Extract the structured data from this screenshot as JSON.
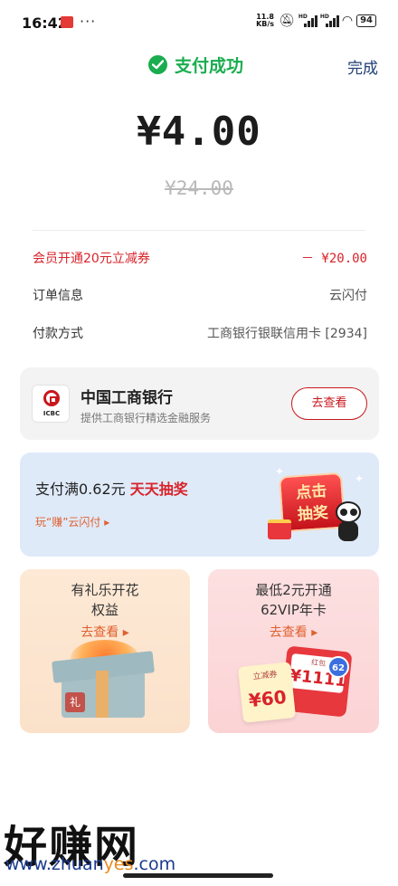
{
  "status_bar": {
    "time": "16:42",
    "network_speed": "11.8\nKB/s",
    "signal_label_1": "HD",
    "signal_label_2": "HD",
    "battery": "94"
  },
  "header": {
    "title": "支付成功",
    "done_label": "完成"
  },
  "payment": {
    "amount": "¥4.00",
    "original_amount": "¥24.00"
  },
  "details": [
    {
      "label": "会员开通20元立减券",
      "value": "－ ¥20.00"
    },
    {
      "label": "订单信息",
      "value": "云闪付"
    },
    {
      "label": "付款方式",
      "value": "工商银行银联信用卡 [2934]"
    }
  ],
  "bank_card": {
    "logo_text": "ICBC",
    "name": "中国工商银行",
    "subtitle": "提供工商银行精选金融服务",
    "button_label": "去查看"
  },
  "lottery_card": {
    "title_prefix": "支付满0.62元",
    "title_highlight": "天天抽奖",
    "subtitle": "玩“赚”云闪付 ▸",
    "button_line1": "点击",
    "button_line2": "抽奖"
  },
  "promo_left": {
    "title_line1": "有礼乐开花",
    "title_line2": "权益",
    "link": "去查看 ▸",
    "tag": "礼"
  },
  "promo_right": {
    "title_line1": "最低2元开通",
    "title_line2": "62VIP年卡",
    "link": "去查看 ▸",
    "coupon_label": "立减券",
    "coupon_value": "¥60",
    "redpack_label": "红包",
    "redpack_value": "¥1111",
    "badge": "62"
  },
  "watermark": {
    "text": "好赚网",
    "url_part1": "www.zhuan",
    "url_part2": "yes",
    "url_part3": ".com"
  },
  "colors": {
    "success": "#1aad4f",
    "accent_red": "#d8232a",
    "link_blue": "#1f3f77",
    "bank_red": "#c8161d"
  }
}
